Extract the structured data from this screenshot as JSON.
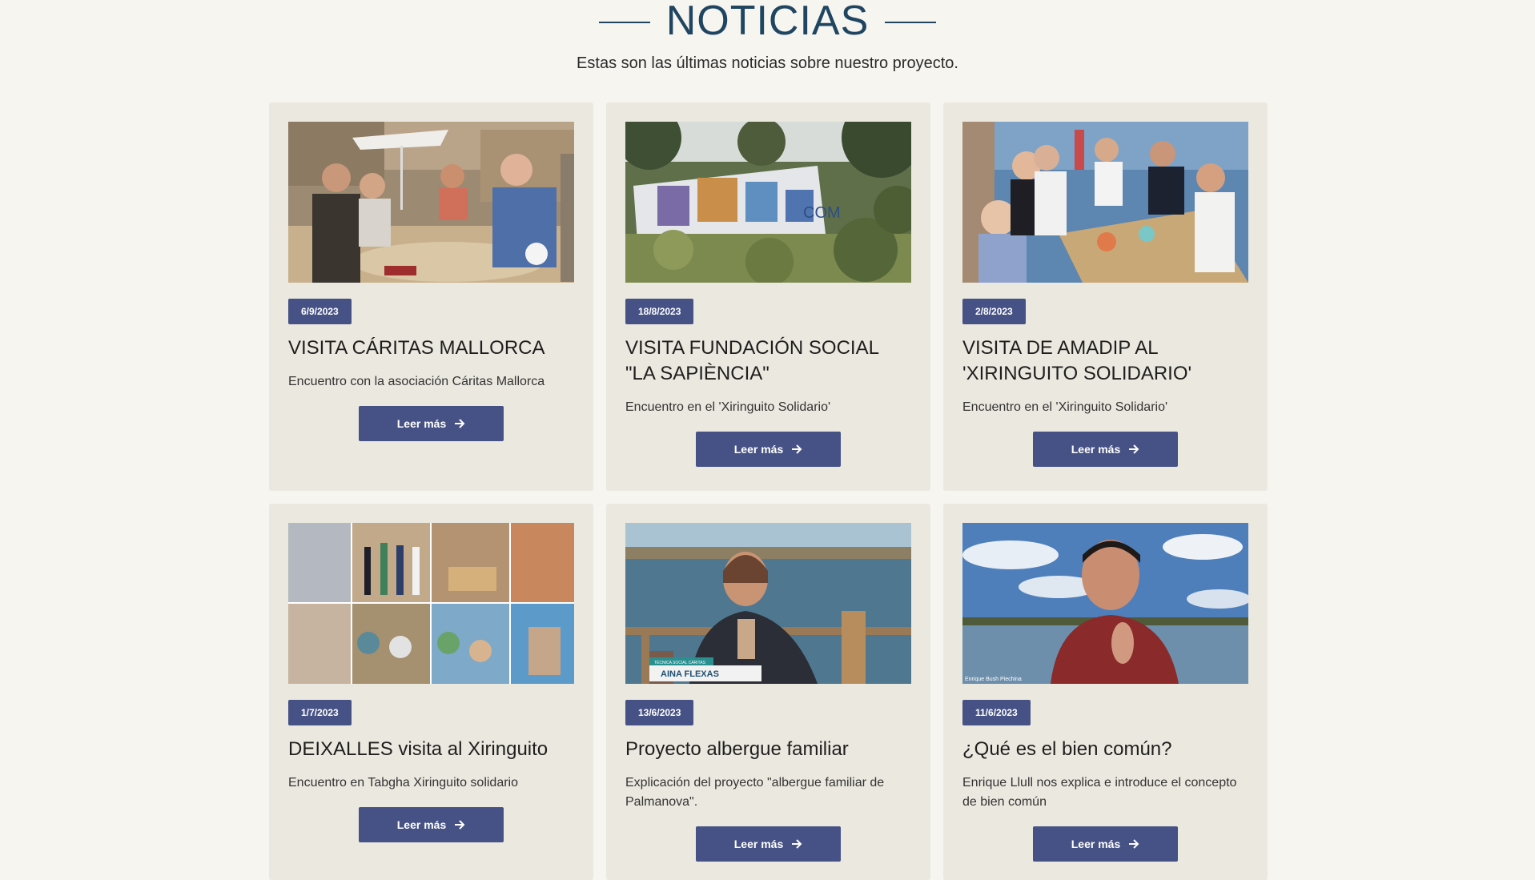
{
  "header": {
    "title": "NOTICIAS",
    "subtitle": "Estas son las últimas noticias sobre nuestro proyecto."
  },
  "colors": {
    "background": "#f6f5f0",
    "card": "#ebe8df",
    "accent": "#465285",
    "title": "#1f4560"
  },
  "news": [
    {
      "date": "6/9/2023",
      "title": "VISITA CÁRITAS MALLORCA",
      "description": "Encuentro con la asociación Cáritas Mallorca",
      "button": "Leer más",
      "image": "group-at-beach-table-photo"
    },
    {
      "date": "18/8/2023",
      "title": "VISITA FUNDACIÓN SOCIAL \"LA SAPIÈNCIA\"",
      "description": "Encuentro en el 'Xiringuito Solidario'",
      "button": "Leer más",
      "image": "mural-wall-among-trees-photo"
    },
    {
      "date": "2/8/2023",
      "title": "VISITA DE AMADIP AL 'XIRINGUITO SOLIDARIO'",
      "description": "Encuentro en el 'Xiringuito Solidario'",
      "button": "Leer más",
      "image": "group-dining-by-sea-photo"
    },
    {
      "date": "1/7/2023",
      "title": "DEIXALLES visita al Xiringuito",
      "description": "Encuentro en Tabgha Xiringuito solidario",
      "button": "Leer más",
      "image": "photo-collage"
    },
    {
      "date": "13/6/2023",
      "title": "Proyecto albergue familiar",
      "description": "Explicación del proyecto \"albergue familiar de Palmanova\".",
      "button": "Leer más",
      "image": "video-still-woman-by-sea",
      "image_caption_small": "TÉCNICA SOCIAL CÁRITAS",
      "image_caption": "AINA FLEXAS"
    },
    {
      "date": "11/6/2023",
      "title": "¿Qué es el bien común?",
      "description": "Enrique Llull nos explica e introduce el concepto de bien común",
      "button": "Leer más",
      "image": "video-still-man-with-lake",
      "image_caption": "Enrique Bush Piechina"
    }
  ]
}
